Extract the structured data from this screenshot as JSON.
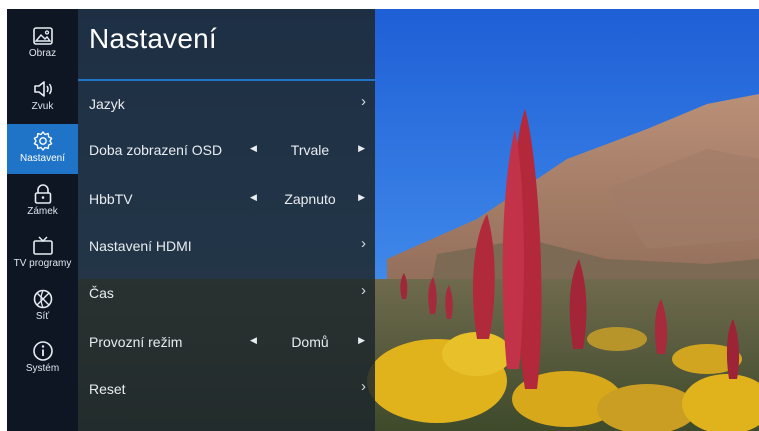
{
  "sidebar": {
    "items": [
      {
        "label": "Obraz",
        "icon": "image-icon",
        "active": false
      },
      {
        "label": "Zvuk",
        "icon": "speaker-icon",
        "active": false
      },
      {
        "label": "Nastavení",
        "icon": "gear-icon",
        "active": true
      },
      {
        "label": "Zámek",
        "icon": "lock-icon",
        "active": false
      },
      {
        "label": "TV programy",
        "icon": "tv-icon",
        "active": false
      },
      {
        "label": "Síť",
        "icon": "network-icon",
        "active": false
      },
      {
        "label": "Systém",
        "icon": "info-icon",
        "active": false
      }
    ]
  },
  "panel": {
    "title": "Nastavení",
    "rows": [
      {
        "label": "Jazyk",
        "type": "submenu"
      },
      {
        "label": "Doba zobrazení OSD",
        "type": "selector",
        "value": "Trvale"
      },
      {
        "label": "HbbTV",
        "type": "selector",
        "value": "Zapnuto"
      },
      {
        "label": "Nastavení HDMI",
        "type": "submenu"
      },
      {
        "label": "Čas",
        "type": "submenu"
      },
      {
        "label": "Provozní režim",
        "type": "selector",
        "value": "Domů"
      },
      {
        "label": "Reset",
        "type": "submenu"
      }
    ]
  },
  "colors": {
    "accent": "#1f74c8",
    "sidebar_bg": "#0d1622",
    "panel_bg": "#1e282c"
  }
}
